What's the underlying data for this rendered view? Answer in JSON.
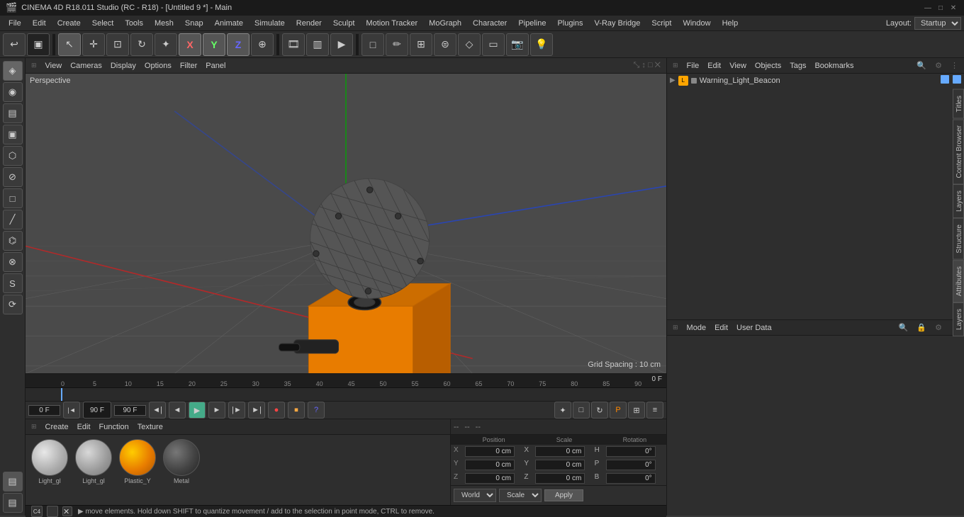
{
  "titleBar": {
    "title": "CINEMA 4D R18.011 Studio (RC - R18) - [Untitled 9 *] - Main",
    "logo": "🎬"
  },
  "menuBar": {
    "items": [
      "File",
      "Edit",
      "Create",
      "Select",
      "Tools",
      "Mesh",
      "Snap",
      "Animate",
      "Simulate",
      "Render",
      "Sculpt",
      "Motion Tracker",
      "MoGraph",
      "Character",
      "Pipeline",
      "Plugins",
      "V-Ray Bridge",
      "Script",
      "Window",
      "Help"
    ],
    "layout_label": "Layout:",
    "layout_value": "Startup"
  },
  "viewport": {
    "menu_items": [
      "View",
      "Cameras",
      "Display",
      "Options",
      "Filter",
      "Panel"
    ],
    "perspective_label": "Perspective",
    "grid_spacing": "Grid Spacing : 10 cm"
  },
  "timeline": {
    "frame_start": "0 F",
    "frame_current": "0 F",
    "frame_end": "90 F",
    "frame_end2": "90 F",
    "ruler_marks": [
      "0",
      "5",
      "10",
      "15",
      "20",
      "25",
      "30",
      "35",
      "40",
      "45",
      "50",
      "55",
      "60",
      "65",
      "70",
      "75",
      "80",
      "85",
      "90"
    ],
    "right_label": "0 F"
  },
  "materials": {
    "toolbar_items": [
      "Create",
      "Edit",
      "Function",
      "Texture"
    ],
    "items": [
      {
        "name": "Light_gl",
        "type": "light_gray"
      },
      {
        "name": "Light_gl",
        "type": "light_gray2"
      },
      {
        "name": "Plastic_Y",
        "type": "orange"
      },
      {
        "name": "Metal",
        "type": "dark"
      }
    ]
  },
  "coords": {
    "toolbar_items": [
      "--",
      "--",
      "--"
    ],
    "rows": [
      {
        "label": "X",
        "val1": "0 cm",
        "sub1": "X",
        "val2": "0 cm",
        "subH": "H",
        "val3": "0°"
      },
      {
        "label": "Y",
        "val1": "0 cm",
        "sub1": "Y",
        "val2": "0 cm",
        "subH": "P",
        "val3": "0°"
      },
      {
        "label": "Z",
        "val1": "0 cm",
        "sub1": "Z",
        "val2": "0 cm",
        "subH": "B",
        "val3": "0°"
      }
    ],
    "world_label": "World",
    "scale_label": "Scale",
    "apply_label": "Apply"
  },
  "objectsPanel": {
    "toolbar_items": [
      "File",
      "Edit",
      "View",
      "Objects",
      "Tags",
      "Bookmarks"
    ],
    "object_name": "Warning_Light_Beacon",
    "dot_color": "#66aaff"
  },
  "attributesPanel": {
    "toolbar_items": [
      "Mode",
      "Edit",
      "User Data"
    ]
  },
  "sideTabs": [
    "Titles",
    "Content Browser",
    "Layers",
    "Structure",
    "Attributes",
    "Layers"
  ],
  "statusBar": {
    "text": "▶ move elements. Hold down SHIFT to quantize movement / add to the selection in point mode, CTRL to remove."
  }
}
